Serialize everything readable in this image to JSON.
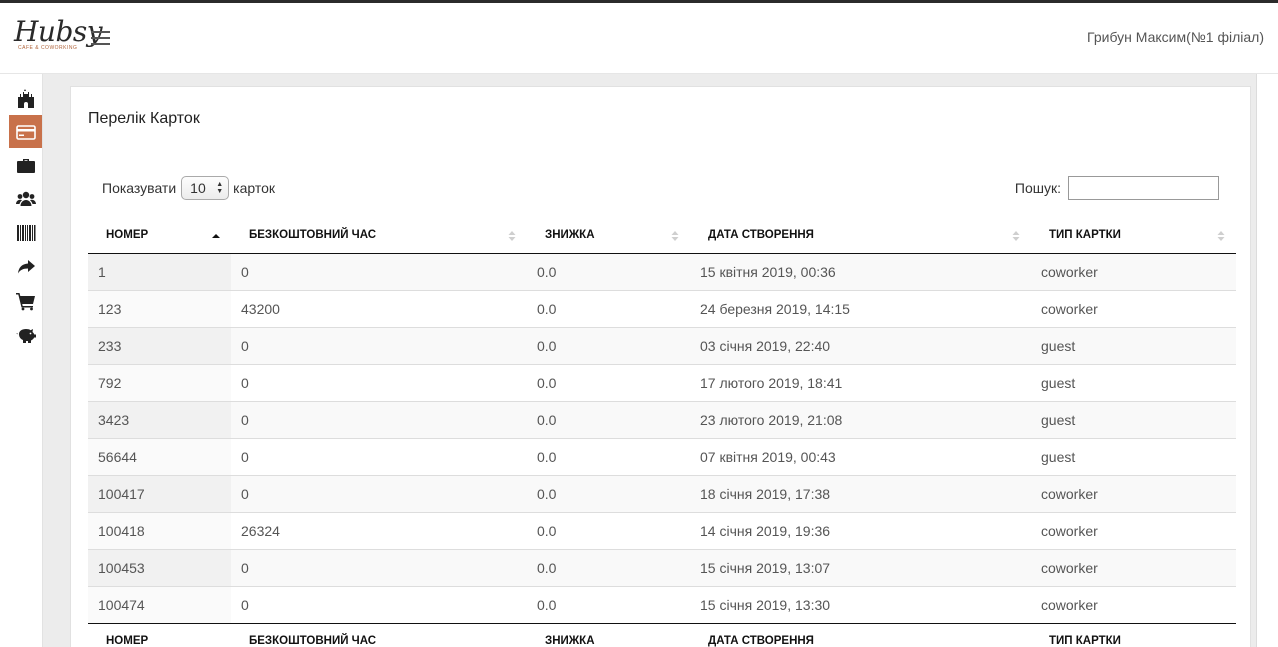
{
  "header": {
    "logo_text": "Hubsy",
    "logo_subtext": "CAFE & COWORKING",
    "user": "Грибун Максим(№1 філіал)"
  },
  "sidebar": {
    "items": [
      {
        "icon": "castle-icon",
        "active": false
      },
      {
        "icon": "credit-card-icon",
        "active": true
      },
      {
        "icon": "briefcase-icon",
        "active": false
      },
      {
        "icon": "users-icon",
        "active": false
      },
      {
        "icon": "barcode-icon",
        "active": false
      },
      {
        "icon": "share-arrow-icon",
        "active": false
      },
      {
        "icon": "cart-icon",
        "active": false
      },
      {
        "icon": "piggy-bank-icon",
        "active": false
      }
    ],
    "active_color": "#c8714a"
  },
  "page": {
    "title": "Перелік Карток"
  },
  "controls": {
    "show_label": "Показувати",
    "page_size": "10",
    "entries_label": "карток",
    "search_label": "Пошук:",
    "search_value": ""
  },
  "table": {
    "columns": [
      "НОМЕР",
      "БЕЗКОШТОВНИЙ ЧАС",
      "ЗНИЖКА",
      "ДАТА СТВОРЕННЯ",
      "ТИП КАРТКИ"
    ],
    "rows": [
      [
        "1",
        "0",
        "0.0",
        "15 квітня 2019, 00:36",
        "coworker"
      ],
      [
        "123",
        "43200",
        "0.0",
        "24 березня 2019, 14:15",
        "coworker"
      ],
      [
        "233",
        "0",
        "0.0",
        "03 січня 2019, 22:40",
        "guest"
      ],
      [
        "792",
        "0",
        "0.0",
        "17 лютого 2019, 18:41",
        "guest"
      ],
      [
        "3423",
        "0",
        "0.0",
        "23 лютого 2019, 21:08",
        "guest"
      ],
      [
        "56644",
        "0",
        "0.0",
        "07 квітня 2019, 00:43",
        "guest"
      ],
      [
        "100417",
        "0",
        "0.0",
        "18 січня 2019, 17:38",
        "coworker"
      ],
      [
        "100418",
        "26324",
        "0.0",
        "14 січня 2019, 19:36",
        "coworker"
      ],
      [
        "100453",
        "0",
        "0.0",
        "15 січня 2019, 13:07",
        "coworker"
      ],
      [
        "100474",
        "0",
        "0.0",
        "15 січня 2019, 13:30",
        "coworker"
      ]
    ]
  }
}
